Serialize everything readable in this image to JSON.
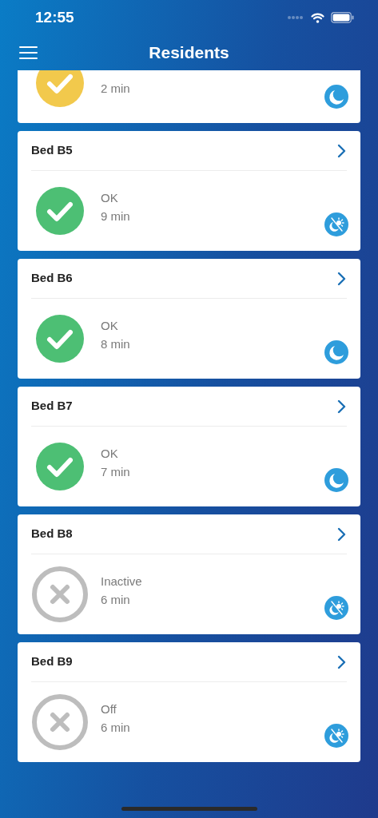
{
  "status_bar": {
    "time": "12:55"
  },
  "nav": {
    "title": "Residents"
  },
  "residents": [
    {
      "kind": "warning",
      "time": "2 min",
      "mode": {
        "kind": "sleep"
      }
    },
    {
      "bed": "Bed B5",
      "kind": "ok",
      "label": "OK",
      "time": "9 min",
      "mode": {
        "kind": "awake"
      }
    },
    {
      "bed": "Bed B6",
      "kind": "ok",
      "label": "OK",
      "time": "8 min",
      "mode": {
        "kind": "sleep"
      }
    },
    {
      "bed": "Bed B7",
      "kind": "ok",
      "label": "OK",
      "time": "7 min",
      "mode": {
        "kind": "sleep"
      }
    },
    {
      "bed": "Bed B8",
      "kind": "inactive",
      "label": "Inactive",
      "time": "6 min",
      "mode": {
        "kind": "awake"
      }
    },
    {
      "bed": "Bed B9",
      "kind": "inactive",
      "label": "Off",
      "time": "6 min",
      "mode": {
        "kind": "awake"
      }
    }
  ]
}
